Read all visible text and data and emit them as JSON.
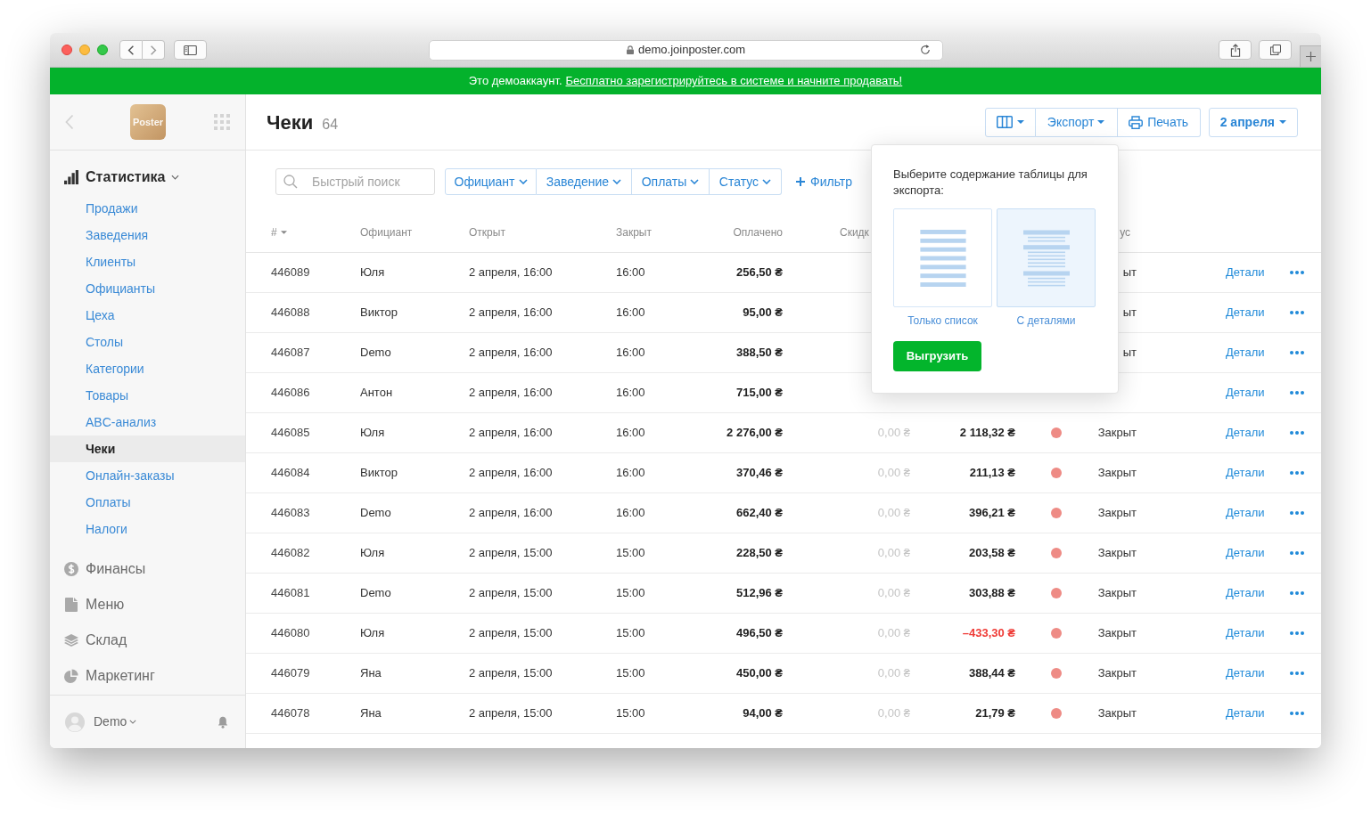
{
  "browser": {
    "url": "demo.joinposter.com"
  },
  "banner": {
    "text": "Это демоаккаунт.",
    "link": "Бесплатно зарегистрируйтесь в системе и начните продавать!"
  },
  "sidebar": {
    "logo": "Poster",
    "sections": [
      {
        "label": "Статистика",
        "expanded": true,
        "children": [
          {
            "label": "Продажи",
            "selected": false
          },
          {
            "label": "Заведения",
            "selected": false
          },
          {
            "label": "Клиенты",
            "selected": false
          },
          {
            "label": "Официанты",
            "selected": false
          },
          {
            "label": "Цеха",
            "selected": false
          },
          {
            "label": "Столы",
            "selected": false
          },
          {
            "label": "Категории",
            "selected": false
          },
          {
            "label": "Товары",
            "selected": false
          },
          {
            "label": "ABC-анализ",
            "selected": false
          },
          {
            "label": "Чеки",
            "selected": true
          },
          {
            "label": "Онлайн-заказы",
            "selected": false
          },
          {
            "label": "Оплаты",
            "selected": false
          },
          {
            "label": "Налоги",
            "selected": false
          }
        ]
      },
      {
        "label": "Финансы"
      },
      {
        "label": "Меню"
      },
      {
        "label": "Склад"
      },
      {
        "label": "Маркетинг"
      }
    ],
    "user": "Demo"
  },
  "header": {
    "title": "Чеки",
    "count": "64",
    "export": "Экспорт",
    "print": "Печать",
    "date": "2 апреля"
  },
  "filters": {
    "search_placeholder": "Быстрый поиск",
    "buttons": [
      "Официант",
      "Заведение",
      "Оплаты",
      "Статус"
    ],
    "add_filter": "Фильтр"
  },
  "table": {
    "columns": [
      "#",
      "Официант",
      "Открыт",
      "Закрыт",
      "Оплачено",
      "Скидк",
      "ус"
    ],
    "rows": [
      {
        "number": "446089",
        "waiter": "Юля",
        "opened": "2 апреля, 16:00",
        "closed": "16:00",
        "paid": "256,50 ₴",
        "status": "ыт",
        "link": "Детали"
      },
      {
        "number": "446088",
        "waiter": "Виктор",
        "opened": "2 апреля, 16:00",
        "closed": "16:00",
        "paid": "95,00 ₴",
        "status": "ыт",
        "link": "Детали"
      },
      {
        "number": "446087",
        "waiter": "Demo",
        "opened": "2 апреля, 16:00",
        "closed": "16:00",
        "paid": "388,50 ₴",
        "status": "ыт",
        "link": "Детали"
      },
      {
        "number": "446086",
        "waiter": "Антон",
        "opened": "2 апреля, 16:00",
        "closed": "16:00",
        "paid": "715,00 ₴",
        "link": "Детали"
      },
      {
        "number": "446085",
        "waiter": "Юля",
        "opened": "2 апреля, 16:00",
        "closed": "16:00",
        "paid": "2 276,00 ₴",
        "discount": "0,00 ₴",
        "profit": {
          "value": "2 118,32 ₴",
          "negative": false
        },
        "color": "#ee8b85",
        "status": "Закрыт",
        "link": "Детали"
      },
      {
        "number": "446084",
        "waiter": "Виктор",
        "opened": "2 апреля, 16:00",
        "closed": "16:00",
        "paid": "370,46 ₴",
        "discount": "0,00 ₴",
        "profit": {
          "value": "211,13 ₴",
          "negative": false
        },
        "color": "#ee8b85",
        "status": "Закрыт",
        "link": "Детали"
      },
      {
        "number": "446083",
        "waiter": "Demo",
        "opened": "2 апреля, 16:00",
        "closed": "16:00",
        "paid": "662,40 ₴",
        "discount": "0,00 ₴",
        "profit": {
          "value": "396,21 ₴",
          "negative": false
        },
        "color": "#ee8b85",
        "status": "Закрыт",
        "link": "Детали"
      },
      {
        "number": "446082",
        "waiter": "Юля",
        "opened": "2 апреля, 15:00",
        "closed": "15:00",
        "paid": "228,50 ₴",
        "discount": "0,00 ₴",
        "profit": {
          "value": "203,58 ₴",
          "negative": false
        },
        "color": "#ee8b85",
        "status": "Закрыт",
        "link": "Детали"
      },
      {
        "number": "446081",
        "waiter": "Demo",
        "opened": "2 апреля, 15:00",
        "closed": "15:00",
        "paid": "512,96 ₴",
        "discount": "0,00 ₴",
        "profit": {
          "value": "303,88 ₴",
          "negative": false
        },
        "color": "#ee8b85",
        "status": "Закрыт",
        "link": "Детали"
      },
      {
        "number": "446080",
        "waiter": "Юля",
        "opened": "2 апреля, 15:00",
        "closed": "15:00",
        "paid": "496,50 ₴",
        "discount": "0,00 ₴",
        "profit": {
          "value": "–433,30 ₴",
          "negative": true
        },
        "color": "#ee8b85",
        "status": "Закрыт",
        "link": "Детали"
      },
      {
        "number": "446079",
        "waiter": "Яна",
        "opened": "2 апреля, 15:00",
        "closed": "15:00",
        "paid": "450,00 ₴",
        "discount": "0,00 ₴",
        "profit": {
          "value": "388,44 ₴",
          "negative": false
        },
        "color": "#ee8b85",
        "status": "Закрыт",
        "link": "Детали"
      },
      {
        "number": "446078",
        "waiter": "Яна",
        "opened": "2 апреля, 15:00",
        "closed": "15:00",
        "paid": "94,00 ₴",
        "discount": "0,00 ₴",
        "profit": {
          "value": "21,79 ₴",
          "negative": false
        },
        "color": "#ee8b85",
        "status": "Закрыт",
        "link": "Детали"
      }
    ]
  },
  "export_popup": {
    "prompt": "Выберите содержание таблицы для экспорта:",
    "options": [
      {
        "label": "Только список",
        "selected": false
      },
      {
        "label": "С деталями",
        "selected": true
      }
    ],
    "button": "Выгрузить"
  }
}
